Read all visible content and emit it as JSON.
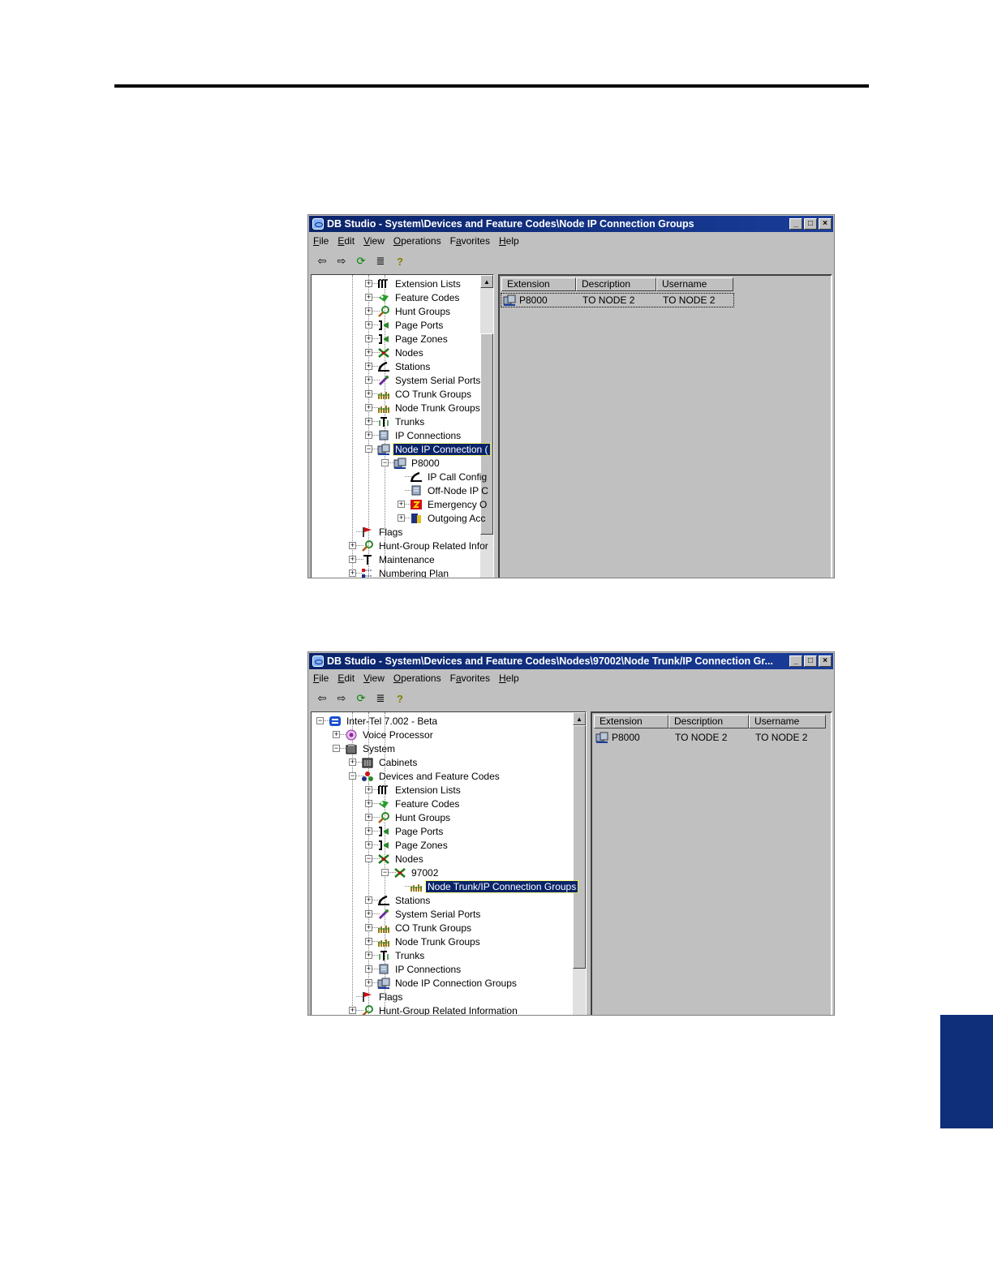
{
  "windows": [
    {
      "title": "DB Studio - System\\Devices and Feature Codes\\Node IP Connection Groups",
      "menu": [
        {
          "pre": "",
          "ul": "F",
          "post": "ile"
        },
        {
          "pre": "",
          "ul": "E",
          "post": "dit"
        },
        {
          "pre": "",
          "ul": "V",
          "post": "iew"
        },
        {
          "pre": "",
          "ul": "O",
          "post": "perations"
        },
        {
          "pre": "F",
          "ul": "a",
          "post": "vorites"
        },
        {
          "pre": "",
          "ul": "H",
          "post": "elp"
        }
      ],
      "tree": [
        {
          "label": "Extension Lists",
          "icon": "extension-lists-icon",
          "level": 3,
          "expander": "+"
        },
        {
          "label": "Feature Codes",
          "icon": "feature-codes-icon",
          "level": 3,
          "expander": "+"
        },
        {
          "label": "Hunt Groups",
          "icon": "hunt-groups-icon",
          "level": 3,
          "expander": "+"
        },
        {
          "label": "Page Ports",
          "icon": "page-ports-icon",
          "level": 3,
          "expander": "+"
        },
        {
          "label": "Page Zones",
          "icon": "page-zones-icon",
          "level": 3,
          "expander": "+"
        },
        {
          "label": "Nodes",
          "icon": "nodes-icon",
          "level": 3,
          "expander": "+"
        },
        {
          "label": "Stations",
          "icon": "stations-icon",
          "level": 3,
          "expander": "+"
        },
        {
          "label": "System Serial Ports",
          "icon": "serial-ports-icon",
          "level": 3,
          "expander": "+"
        },
        {
          "label": "CO Trunk Groups",
          "icon": "trunk-groups-icon",
          "level": 3,
          "expander": "+"
        },
        {
          "label": "Node Trunk Groups",
          "icon": "trunk-groups-icon",
          "level": 3,
          "expander": "+"
        },
        {
          "label": "Trunks",
          "icon": "trunks-icon",
          "level": 3,
          "expander": "+"
        },
        {
          "label": "IP Connections",
          "icon": "ip-connections-icon",
          "level": 3,
          "expander": "+"
        },
        {
          "label": "Node IP Connection (",
          "icon": "ip-connection-groups-icon",
          "level": 3,
          "expander": "-",
          "selected": true
        },
        {
          "label": "P8000",
          "icon": "ip-connection-groups-icon",
          "level": 4,
          "expander": "-"
        },
        {
          "label": "IP Call Config",
          "icon": "stations-icon",
          "level": 5,
          "expander": ""
        },
        {
          "label": "Off-Node IP C",
          "icon": "ip-connections-icon",
          "level": 5,
          "expander": ""
        },
        {
          "label": "Emergency O",
          "icon": "emergency-icon",
          "level": 5,
          "expander": "+"
        },
        {
          "label": "Outgoing Acc",
          "icon": "outgoing-access-icon",
          "level": 5,
          "expander": "+"
        },
        {
          "label": "Flags",
          "icon": "flags-icon",
          "level": 2,
          "expander": ""
        },
        {
          "label": "Hunt-Group Related Infor",
          "icon": "hunt-groups-icon",
          "level": 2,
          "expander": "+"
        },
        {
          "label": "Maintenance",
          "icon": "maintenance-icon",
          "level": 2,
          "expander": "+"
        },
        {
          "label": "Numbering Plan",
          "icon": "numbering-plan-icon",
          "level": 2,
          "expander": "+"
        }
      ],
      "columns": [
        "Extension",
        "Description",
        "Username"
      ],
      "rows": [
        {
          "extension": "P8000",
          "description": "TO NODE 2",
          "username": "TO NODE 2"
        }
      ]
    },
    {
      "title": "DB Studio - System\\Devices and Feature Codes\\Nodes\\97002\\Node Trunk/IP Connection Gr...",
      "menu": [
        {
          "pre": "",
          "ul": "F",
          "post": "ile"
        },
        {
          "pre": "",
          "ul": "E",
          "post": "dit"
        },
        {
          "pre": "",
          "ul": "V",
          "post": "iew"
        },
        {
          "pre": "",
          "ul": "O",
          "post": "perations"
        },
        {
          "pre": "F",
          "ul": "a",
          "post": "vorites"
        },
        {
          "pre": "",
          "ul": "H",
          "post": "elp"
        }
      ],
      "tree": [
        {
          "label": "Inter-Tel 7.002 - Beta",
          "icon": "root-icon",
          "level": 0,
          "expander": "-"
        },
        {
          "label": "Voice Processor",
          "icon": "voice-processor-icon",
          "level": 1,
          "expander": "+"
        },
        {
          "label": "System",
          "icon": "system-icon",
          "level": 1,
          "expander": "-"
        },
        {
          "label": "Cabinets",
          "icon": "cabinets-icon",
          "level": 2,
          "expander": "+"
        },
        {
          "label": "Devices and Feature Codes",
          "icon": "devices-icon",
          "level": 2,
          "expander": "-"
        },
        {
          "label": "Extension Lists",
          "icon": "extension-lists-icon",
          "level": 3,
          "expander": "+"
        },
        {
          "label": "Feature Codes",
          "icon": "feature-codes-icon",
          "level": 3,
          "expander": "+"
        },
        {
          "label": "Hunt Groups",
          "icon": "hunt-groups-icon",
          "level": 3,
          "expander": "+"
        },
        {
          "label": "Page Ports",
          "icon": "page-ports-icon",
          "level": 3,
          "expander": "+"
        },
        {
          "label": "Page Zones",
          "icon": "page-zones-icon",
          "level": 3,
          "expander": "+"
        },
        {
          "label": "Nodes",
          "icon": "nodes-icon",
          "level": 3,
          "expander": "-"
        },
        {
          "label": "97002",
          "icon": "nodes-icon",
          "level": 4,
          "expander": "-"
        },
        {
          "label": "Node Trunk/IP Connection Groups",
          "icon": "trunk-groups-icon",
          "level": 5,
          "expander": "",
          "selected": true
        },
        {
          "label": "Stations",
          "icon": "stations-icon",
          "level": 3,
          "expander": "+"
        },
        {
          "label": "System Serial Ports",
          "icon": "serial-ports-icon",
          "level": 3,
          "expander": "+"
        },
        {
          "label": "CO Trunk Groups",
          "icon": "trunk-groups-icon",
          "level": 3,
          "expander": "+"
        },
        {
          "label": "Node Trunk Groups",
          "icon": "trunk-groups-icon",
          "level": 3,
          "expander": "+"
        },
        {
          "label": "Trunks",
          "icon": "trunks-icon",
          "level": 3,
          "expander": "+"
        },
        {
          "label": "IP Connections",
          "icon": "ip-connections-icon",
          "level": 3,
          "expander": "+"
        },
        {
          "label": "Node IP Connection Groups",
          "icon": "ip-connection-groups-icon",
          "level": 3,
          "expander": "+"
        },
        {
          "label": "Flags",
          "icon": "flags-icon",
          "level": 2,
          "expander": ""
        },
        {
          "label": "Hunt-Group Related Information",
          "icon": "hunt-groups-icon",
          "level": 2,
          "expander": "+"
        }
      ],
      "columns": [
        "Extension",
        "Description",
        "Username"
      ],
      "rows": [
        {
          "extension": "P8000",
          "description": "TO NODE 2",
          "username": "TO NODE 2"
        }
      ]
    }
  ],
  "colors": {
    "title_bar": "#0a246a",
    "selection": "#0a246a",
    "window_face": "#c0c0c0",
    "side_tab": "#0f2f7a"
  }
}
